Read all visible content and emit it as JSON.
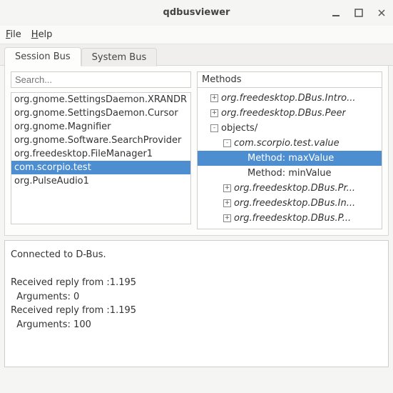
{
  "titlebar": {
    "title": "qdbusviewer"
  },
  "menubar": {
    "file": "File",
    "help": "Help"
  },
  "tabs": {
    "session": "Session Bus",
    "system": "System Bus"
  },
  "search": {
    "placeholder": "Search..."
  },
  "services": [
    {
      "name": "org.gnome.SettingsDaemon.XRANDR",
      "selected": false
    },
    {
      "name": "org.gnome.SettingsDaemon.Cursor",
      "selected": false
    },
    {
      "name": "org.gnome.Magnifier",
      "selected": false
    },
    {
      "name": "org.gnome.Software.SearchProvider",
      "selected": false
    },
    {
      "name": "org.freedesktop.FileManager1",
      "selected": false
    },
    {
      "name": "com.scorpio.test",
      "selected": true
    },
    {
      "name": "org.PulseAudio1",
      "selected": false
    }
  ],
  "methods": {
    "header": "Methods",
    "tree": [
      {
        "indent": 18,
        "expander": "+",
        "label": "org.freedesktop.DBus.Intro...",
        "italic": true
      },
      {
        "indent": 18,
        "expander": "+",
        "label": "org.freedesktop.DBus.Peer",
        "italic": true
      },
      {
        "indent": 18,
        "expander": "-",
        "label": "objects/",
        "italic": false
      },
      {
        "indent": 36,
        "expander": "-",
        "label": "com.scorpio.test.value",
        "italic": true
      },
      {
        "indent": 70,
        "expander": "",
        "label": "Method: maxValue",
        "italic": false,
        "selected": true
      },
      {
        "indent": 70,
        "expander": "",
        "label": "Method: minValue",
        "italic": false
      },
      {
        "indent": 36,
        "expander": "+",
        "label": "org.freedesktop.DBus.Pr...",
        "italic": true
      },
      {
        "indent": 36,
        "expander": "+",
        "label": "org.freedesktop.DBus.In...",
        "italic": true
      },
      {
        "indent": 36,
        "expander": "+",
        "label": "org.freedesktop.DBus.P...",
        "italic": true
      }
    ]
  },
  "log": "Connected to D-Bus.\n\nReceived reply from :1.195\n  Arguments: 0\nReceived reply from :1.195\n  Arguments: 100"
}
